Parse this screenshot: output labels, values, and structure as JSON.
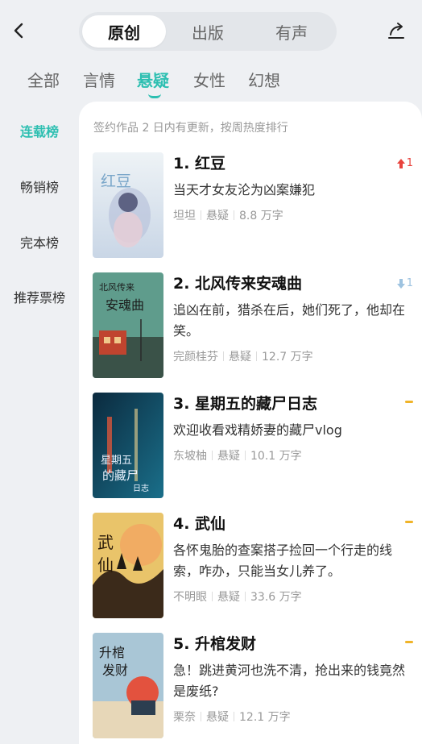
{
  "header": {
    "segments": [
      "原创",
      "出版",
      "有声"
    ],
    "active_segment": 0
  },
  "categories": [
    "全部",
    "言情",
    "悬疑",
    "女性",
    "幻想"
  ],
  "active_category": 2,
  "sidebar": {
    "items": [
      "连载榜",
      "畅销榜",
      "完本榜",
      "推荐票榜"
    ],
    "active": 0
  },
  "panel": {
    "note": "签约作品 2 日内有更新，按周热度排行"
  },
  "books": [
    {
      "title": "1. 红豆",
      "desc": "当天才女友沦为凶案嫌犯",
      "author": "坦坦",
      "genre": "悬疑",
      "heat": "8.8 万字",
      "trend": "up",
      "trend_value": "1",
      "cover_text": "红豆"
    },
    {
      "title": "2. 北风传来安魂曲",
      "desc": "追凶在前，猎杀在后，她们死了，他却在笑。",
      "author": "完颜桂芬",
      "genre": "悬疑",
      "heat": "12.7 万字",
      "trend": "down",
      "trend_value": "1",
      "cover_text": "北风传来安魂曲"
    },
    {
      "title": "3. 星期五的藏尸日志",
      "desc": "欢迎收看戏精娇妻的藏尸vlog",
      "author": "东坡柚",
      "genre": "悬疑",
      "heat": "10.1 万字",
      "trend": "flat",
      "trend_value": "",
      "cover_text": "星期五的藏尸日志"
    },
    {
      "title": "4. 武仙",
      "desc": "各怀鬼胎的查案搭子捡回一个行走的线索，咋办，只能当女儿养了。",
      "author": "不明眼",
      "genre": "悬疑",
      "heat": "33.6 万字",
      "trend": "flat",
      "trend_value": "",
      "cover_text": "武仙"
    },
    {
      "title": "5. 升棺发财",
      "desc": "急！跳进黄河也洗不清，抢出来的钱竟然是废纸?",
      "author": "栗奈",
      "genre": "悬疑",
      "heat": "12.1 万字",
      "trend": "flat",
      "trend_value": "",
      "cover_text": "升棺发财"
    }
  ],
  "colors": {
    "accent": "#2dbfb1",
    "trend_up": "#e8433d",
    "trend_down": "#9ec3e0",
    "trend_flat": "#f0b429"
  }
}
